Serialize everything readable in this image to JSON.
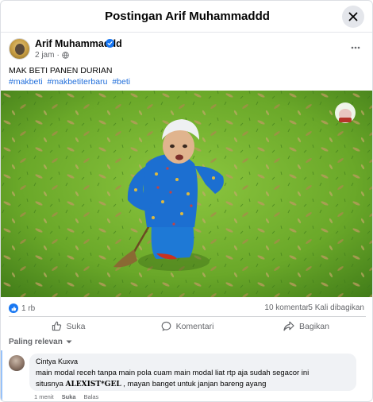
{
  "dialog": {
    "title": "Postingan Arif Muhammaddd"
  },
  "post": {
    "author": "Arif Muhammaddd",
    "time": "2 jam",
    "separator": "·",
    "text": "MAK BETI PANEN DURIAN",
    "hashtags": [
      "#makbeti",
      "#makbetiterbaru",
      "#beti"
    ],
    "image_alt": "Woman in blue patterned dress and white head wrap sweeping leaves on grass"
  },
  "stats": {
    "likes": "1 rb",
    "comments": "10 komentar",
    "shares": "5 Kali dibagikan"
  },
  "actions": {
    "like": "Suka",
    "comment": "Komentari",
    "share": "Bagikan"
  },
  "sort": {
    "label": "Paling relevan"
  },
  "comment": {
    "author": "Cintya Kuxva",
    "text_line1": "main modal receh tanpa main pola cuam main modal liat rtp aja sudah segacor ini",
    "text_line2_prefix": "situsnya ",
    "text_line2_bold": "ALEXIST*GEL",
    "text_line2_suffix": " , mayan banget untuk janjan bareng ayang",
    "time": "1 menit",
    "like_label": "Suka",
    "reply_label": "Balas"
  },
  "colors": {
    "brand_blue": "#1877f2",
    "link_blue": "#216fdb",
    "muted_text": "#65676b",
    "bubble_bg": "#f0f2f5"
  },
  "icons": {
    "close": "close-icon",
    "verified": "verified-badge-icon",
    "globe": "globe-icon",
    "more": "more-horizontal-icon",
    "like_badge": "thumbs-up-badge-icon",
    "like": "thumbs-up-icon",
    "comment": "comment-bubble-icon",
    "share": "share-arrow-icon",
    "sort": "chevron-down-icon"
  }
}
